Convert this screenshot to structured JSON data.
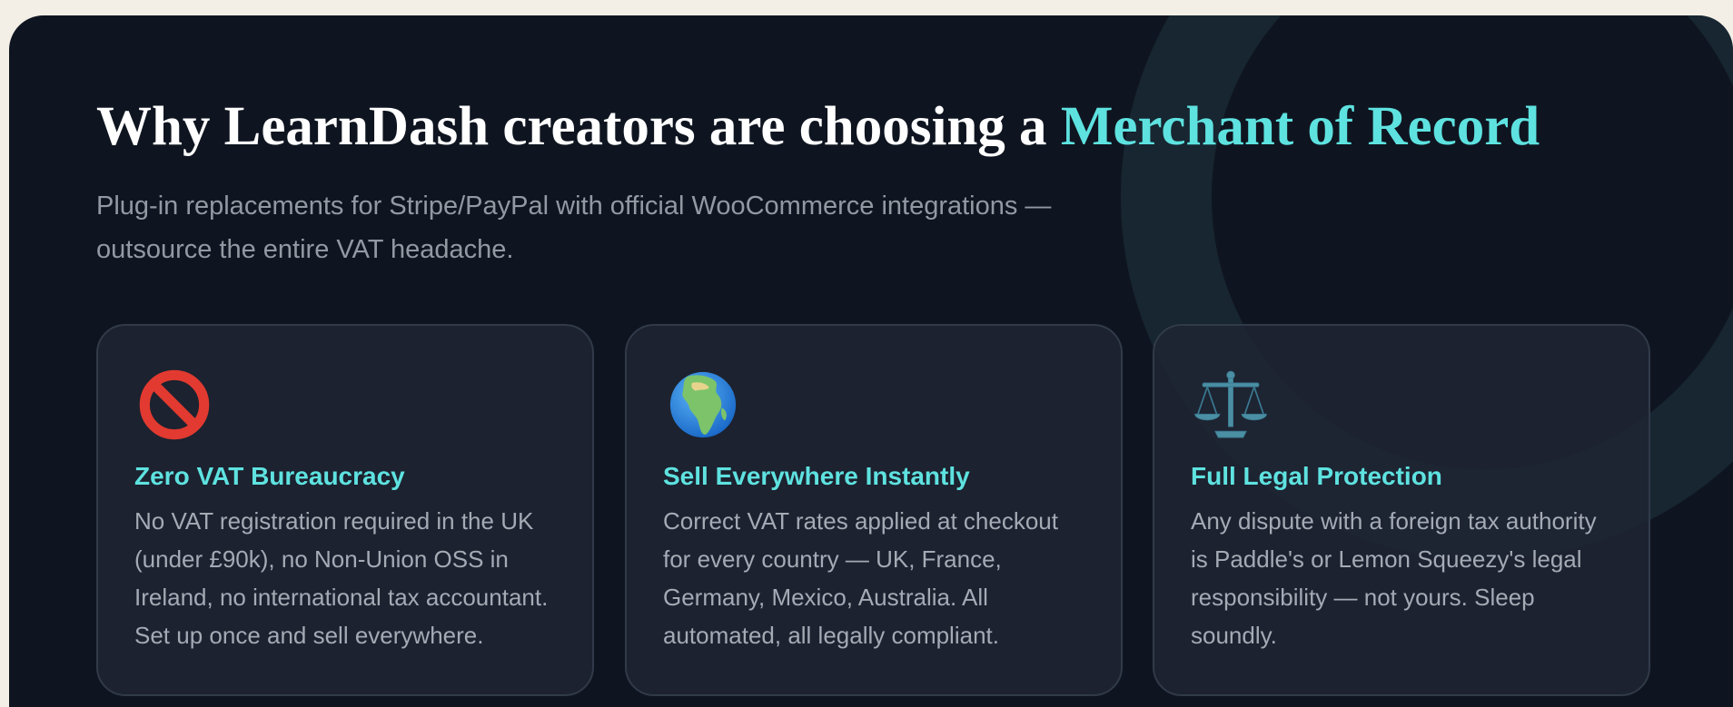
{
  "hero": {
    "title_prefix": "Why LearnDash creators are choosing a ",
    "title_highlight": "Merchant of Record",
    "subtitle": "Plug-in replacements for Stripe/PayPal with official WooCommerce integrations — outsource the entire VAT headache."
  },
  "colors": {
    "background": "#0f1520",
    "accent": "#5ee2e0",
    "page": "#f3efe6"
  },
  "cards": [
    {
      "icon": "prohibited-icon",
      "title": "Zero VAT Bureaucracy",
      "text": "No VAT registration required in the UK (under £90k), no Non-Union OSS in Ireland, no international tax accountant. Set up once and sell everywhere."
    },
    {
      "icon": "globe-africa-icon",
      "title": "Sell Everywhere Instantly",
      "text": "Correct VAT rates applied at checkout for every country — UK, France, Germany, Mexico, Australia. All automated, all legally compliant."
    },
    {
      "icon": "balance-scale-icon",
      "title": "Full Legal Protection",
      "text": "Any dispute with a foreign tax authority is Paddle's or Lemon Squeezy's legal responsibility — not yours. Sleep soundly."
    }
  ]
}
